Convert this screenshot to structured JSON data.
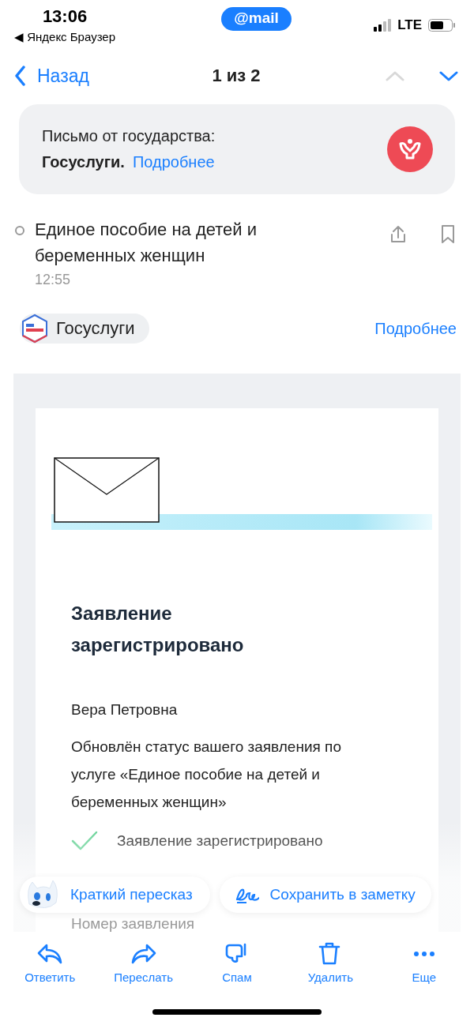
{
  "status_bar": {
    "time": "13:06",
    "back_app": "◀ Яндекс Браузер",
    "app_badge": "@mail",
    "network": "LTE"
  },
  "nav": {
    "back": "Назад",
    "counter": "1 из 2",
    "arrows": [
      {
        "kind": "up",
        "disabled": true
      },
      {
        "kind": "down",
        "disabled": false
      }
    ]
  },
  "banner": {
    "text": "Письмо от государства:",
    "sender": "Госуслуги.",
    "link": "Подробнее"
  },
  "message": {
    "subject": "Единое пособие на детей и беременных женщин",
    "time": "12:55",
    "unread": false,
    "sender": "Госуслуги",
    "details_link": "Подробнее"
  },
  "letter": {
    "title": "Заявление зарегистрировано",
    "greeting": "Вера Петровна",
    "body": "Обновлён статус вашего заявления по услуге «Единое пособие на детей и беременных женщин»",
    "checklist": [
      {
        "label": "Заявление зарегистрировано",
        "checked": true
      }
    ],
    "field_label": "Номер заявления"
  },
  "quick_actions": [
    {
      "kind": "summary",
      "label": "Краткий пересказ"
    },
    {
      "kind": "note",
      "label": "Сохранить в заметку"
    }
  ],
  "toolbar": [
    {
      "kind": "reply",
      "label": "Ответить"
    },
    {
      "kind": "forward",
      "label": "Переслать"
    },
    {
      "kind": "spam",
      "label": "Спам"
    },
    {
      "kind": "delete",
      "label": "Удалить"
    },
    {
      "kind": "more",
      "label": "Еще"
    }
  ]
}
